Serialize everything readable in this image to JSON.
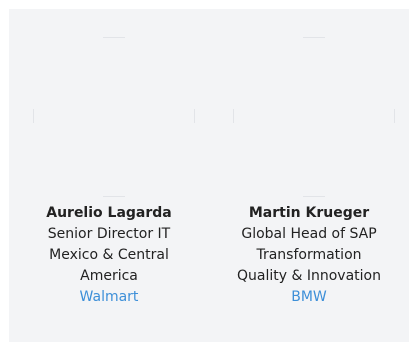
{
  "speakers": [
    {
      "name": "Aurelio Lagarda",
      "title_lines": [
        "Senior Director IT",
        "Mexico & Central",
        "America"
      ],
      "company": "Walmart"
    },
    {
      "name": "Martin Krueger",
      "title_lines": [
        "Global Head of SAP",
        "Transformation",
        "Quality & Innovation"
      ],
      "company": "BMW"
    }
  ],
  "colors": {
    "panel_background": "#f3f4f6",
    "text": "#222222",
    "link": "#3d8fd8"
  }
}
